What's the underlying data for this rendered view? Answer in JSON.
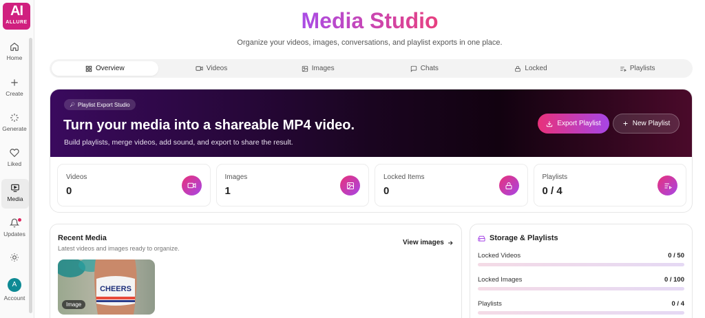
{
  "brand": {
    "logo_main": "AI",
    "logo_sub": "ALLURE"
  },
  "sidebar": {
    "items": [
      {
        "label": "Home",
        "icon": "home-icon"
      },
      {
        "label": "Create",
        "icon": "plus-icon"
      },
      {
        "label": "Generate",
        "icon": "sparkle-loader-icon"
      },
      {
        "label": "Liked",
        "icon": "heart-icon"
      },
      {
        "label": "Media",
        "icon": "media-screen-icon",
        "active": true
      },
      {
        "label": "Updates",
        "icon": "bell-icon"
      },
      {
        "label": "",
        "icon": "sun-icon"
      },
      {
        "label": "Account",
        "icon": "avatar",
        "avatar_letter": "A"
      }
    ]
  },
  "header": {
    "title": "Media Studio",
    "subtitle": "Organize your videos, images, conversations, and playlist exports in one place."
  },
  "tabs": [
    {
      "label": "Overview",
      "icon": "grid-icon",
      "active": true
    },
    {
      "label": "Videos",
      "icon": "video-icon"
    },
    {
      "label": "Images",
      "icon": "image-icon"
    },
    {
      "label": "Chats",
      "icon": "chat-icon"
    },
    {
      "label": "Locked",
      "icon": "lock-icon"
    },
    {
      "label": "Playlists",
      "icon": "playlist-icon"
    }
  ],
  "hero": {
    "badge": "Playlist Export Studio",
    "title": "Turn your media into a shareable MP4 video.",
    "description": "Build playlists, merge videos, add sound, and export to share the result.",
    "export_button": "Export Playlist",
    "new_button": "New Playlist"
  },
  "stats": [
    {
      "label": "Videos",
      "value": "0",
      "icon": "video-icon"
    },
    {
      "label": "Images",
      "value": "1",
      "icon": "image-icon"
    },
    {
      "label": "Locked Items",
      "value": "0",
      "icon": "lock-icon"
    },
    {
      "label": "Playlists",
      "value": "0 / 4",
      "icon": "playlist-icon"
    }
  ],
  "recent": {
    "title": "Recent Media",
    "subtitle": "Latest videos and images ready to organize.",
    "view_link": "View images",
    "thumb_text": "CHEERS",
    "thumb_badge": "Image"
  },
  "storage": {
    "title": "Storage & Playlists",
    "rows": [
      {
        "label": "Locked Videos",
        "value": "0 / 50"
      },
      {
        "label": "Locked Images",
        "value": "0 / 100"
      },
      {
        "label": "Playlists",
        "value": "0 / 4"
      }
    ]
  },
  "colors": {
    "accent_pink": "#e8317a",
    "accent_purple": "#a646e6",
    "hero_dark": "#1a0520"
  }
}
